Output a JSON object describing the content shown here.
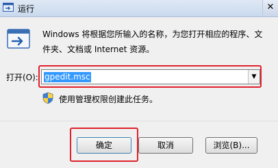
{
  "window": {
    "title": "运行",
    "close_glyph": "✕"
  },
  "dialog": {
    "description": "Windows 将根据您所输入的名称，为您打开相应的程序、文件夹、文档或 Internet 资源。",
    "open_label": "打开(O):",
    "input_value": "gpedit.msc",
    "admin_note": "使用管理权限创建此任务。"
  },
  "buttons": {
    "ok": "确定",
    "cancel": "取消",
    "browse": "浏览(B)..."
  },
  "icons": {
    "app": "run-app-icon",
    "run": "run-program-icon",
    "shield": "uac-shield-icon",
    "dropdown": "chevron-down-icon"
  },
  "colors": {
    "highlight_outline": "#e0212b",
    "selection": "#3399ff"
  }
}
